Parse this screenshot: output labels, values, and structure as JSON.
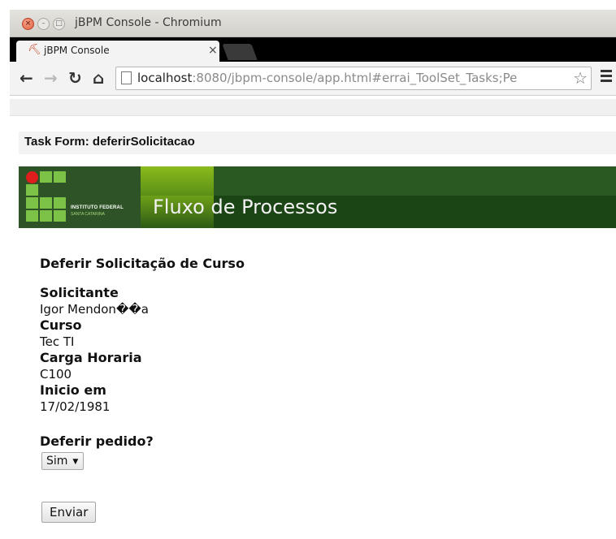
{
  "window": {
    "title": "jBPM Console - Chromium"
  },
  "tab": {
    "title": "jBPM Console",
    "close_glyph": "×"
  },
  "toolbar": {
    "url_host": "localhost",
    "url_rest": ":8080/jbpm-console/app.html#errai_ToolSet_Tasks;Pe",
    "icons": [
      "back-icon",
      "forward-icon",
      "reload-icon",
      "home-icon",
      "page-icon",
      "star-icon",
      "menu-icon"
    ]
  },
  "task": {
    "title": "Task Form: deferirSolicitacao"
  },
  "banner": {
    "title": "Fluxo de Processos",
    "logo_line1": "INSTITUTO FEDERAL",
    "logo_line2": "SANTA CATARINA",
    "colors": {
      "dark_green": "#1c4516",
      "light_green": "#7bc247",
      "red": "#e01d1d"
    }
  },
  "form": {
    "heading": "Deferir Solicitação de Curso",
    "fields": [
      {
        "label": "Solicitante",
        "value": "Igor Mendon��a"
      },
      {
        "label": "Curso",
        "value": "Tec TI"
      },
      {
        "label": "Carga Horaria",
        "value": "C100"
      },
      {
        "label": "Inicio em",
        "value": "17/02/1981"
      }
    ],
    "decision_label": "Deferir pedido?",
    "decision_selected": "Sim",
    "submit_label": "Enviar"
  }
}
